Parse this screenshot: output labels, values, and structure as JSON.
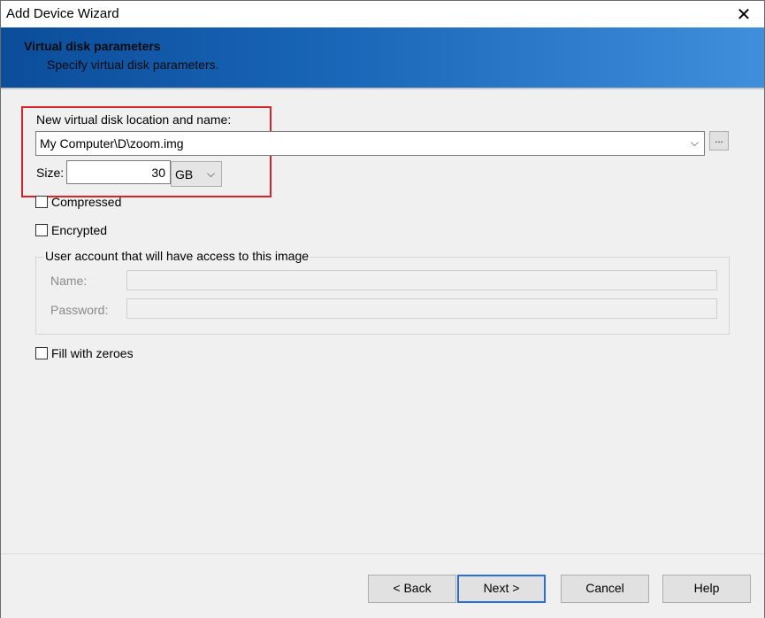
{
  "window": {
    "title": "Add Device Wizard",
    "close_icon": "close-icon"
  },
  "header": {
    "title": "Virtual disk parameters",
    "subtitle": "Specify virtual disk parameters."
  },
  "location": {
    "label": "New virtual disk location and name:",
    "value": "My Computer\\D\\zoom.img",
    "browse_label": "..."
  },
  "size": {
    "label": "Size:",
    "value": "30",
    "unit": "GB"
  },
  "options": {
    "compressed": "Compressed",
    "encrypted": "Encrypted",
    "fill_zeroes": "Fill with zeroes"
  },
  "user_account": {
    "legend": "User account that will have access to this image",
    "name_label": "Name:",
    "password_label": "Password:",
    "name_value": "",
    "password_value": ""
  },
  "buttons": {
    "back": "< Back",
    "next": "Next >",
    "cancel": "Cancel",
    "help": "Help"
  },
  "colors": {
    "highlight": "#d8232a",
    "header_band": "#1a66b8",
    "default_button_border": "#2a6fd6"
  }
}
